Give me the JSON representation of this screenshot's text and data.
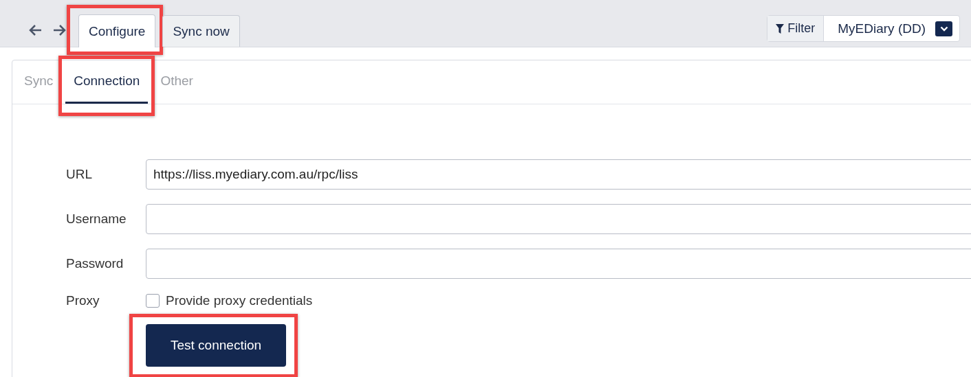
{
  "toolbar": {
    "tabs": [
      {
        "label": "Configure",
        "selected": true,
        "highlighted": true
      },
      {
        "label": "Sync now",
        "selected": false,
        "highlighted": false
      }
    ],
    "filter": {
      "label": "Filter",
      "value": "MyEDiary (DD)"
    }
  },
  "subtabs": [
    {
      "label": "Sync",
      "selected": false,
      "highlighted": false
    },
    {
      "label": "Connection",
      "selected": true,
      "highlighted": true
    },
    {
      "label": "Other",
      "selected": false,
      "highlighted": false
    }
  ],
  "form": {
    "fields": [
      {
        "label": "URL",
        "value": "https://liss.myediary.com.au/rpc/liss"
      },
      {
        "label": "Username"
      },
      {
        "label": "Password"
      }
    ],
    "proxy": {
      "label": "Proxy",
      "option": "Provide proxy credentials",
      "checked": false
    },
    "button": {
      "label": "Test connection",
      "highlighted": true
    }
  }
}
